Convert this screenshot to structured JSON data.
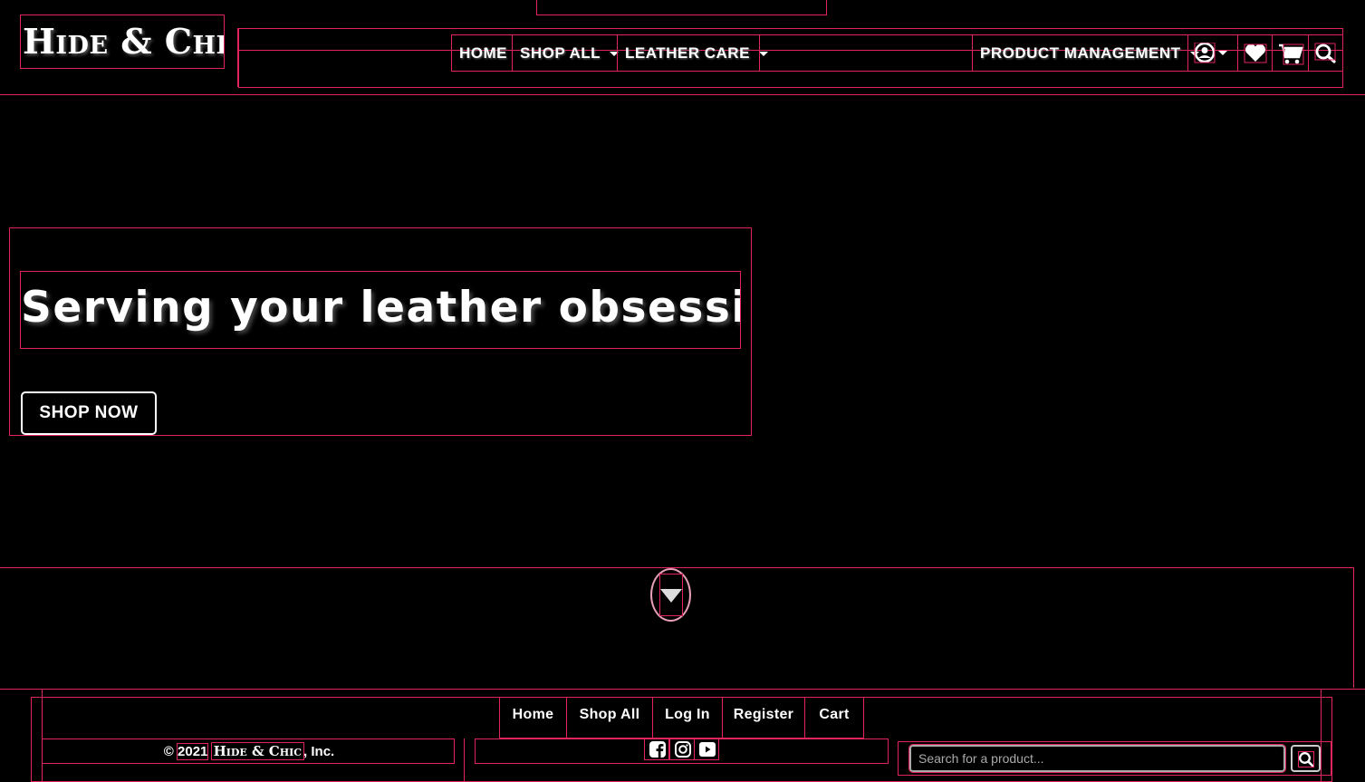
{
  "brand": {
    "name": "Hide & Chic"
  },
  "nav": {
    "home": "HOME",
    "shop_all": "SHOP ALL",
    "leather_care": "LEATHER CARE",
    "product_management": "PRODUCT MANAGEMENT",
    "icons": [
      "user-icon",
      "heart-icon",
      "cart-icon",
      "search-icon"
    ]
  },
  "hero": {
    "title": "Serving your leather obsession...",
    "cta": "SHOP NOW"
  },
  "scroll": {
    "icon": "caret-down-icon"
  },
  "footer": {
    "links": [
      "Home",
      "Shop All",
      "Log In",
      "Register",
      "Cart"
    ],
    "copyright_prefix": "© ",
    "year": "2021",
    "brand": "Hide & Chic",
    "copyright_suffix": ", Inc.",
    "social": [
      "facebook-icon",
      "instagram-icon",
      "youtube-icon"
    ],
    "search_placeholder": "Search for a product..."
  },
  "colors": {
    "background": "#000000",
    "text": "#ffffff",
    "outline": "#e0245e"
  }
}
